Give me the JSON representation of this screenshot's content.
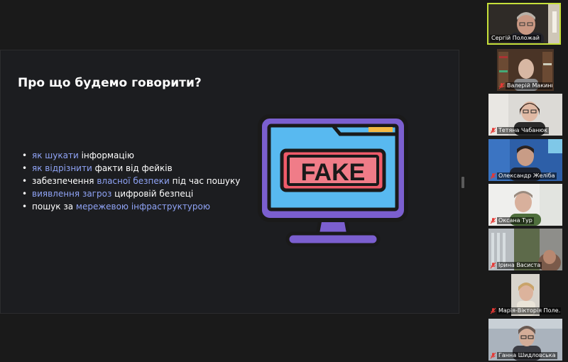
{
  "slide": {
    "title": "Про що будемо говорити?",
    "bullets": [
      {
        "bullet": "•",
        "hl": "як шукати",
        "rest": " інформацію"
      },
      {
        "bullet": "•",
        "hl": "як відрізнити",
        "rest": " факти від фейків"
      },
      {
        "bullet": "•",
        "pre": "забезпечення ",
        "hl": "власної безпеки",
        "rest": " під час пошуку"
      },
      {
        "bullet": "•",
        "hl": "виявлення загроз",
        "rest": " цифровій безпеці"
      },
      {
        "bullet": "•",
        "pre": "пошук за ",
        "hl": "мережевою інфраструктурою"
      }
    ],
    "illustration_text": "FAKE",
    "highlight_color": "#8fa3f5"
  },
  "participants": [
    {
      "name": "Сергій Положай",
      "muted": false,
      "active": true
    },
    {
      "name": "Валерій Макинько",
      "muted": true
    },
    {
      "name": "Тетяна Чабанюк",
      "muted": true
    },
    {
      "name": "Олександр Желіба",
      "muted": true
    },
    {
      "name": "Оксана Тур",
      "muted": true
    },
    {
      "name": "Ірина Васиста",
      "muted": true
    },
    {
      "name": "Марія-Вікторія Поле...",
      "muted": true
    },
    {
      "name": "Ганна Шидловська",
      "muted": true
    }
  ],
  "icons": {
    "muted_mic": "muted-mic-icon"
  },
  "colors": {
    "active_speaker_border": "#c6e03a",
    "muted_red": "#e53935",
    "background": "#1a1a1a"
  }
}
